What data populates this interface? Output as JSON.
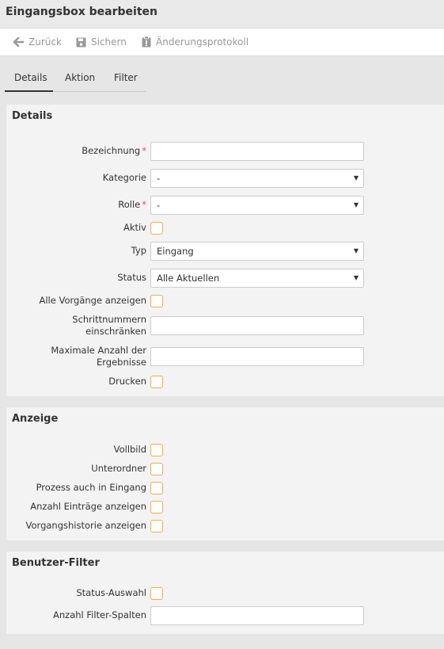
{
  "title": "Eingangsbox bearbeiten",
  "toolbar": {
    "back": "Zurück",
    "save": "Sichern",
    "changelog": "Änderungsprotokoll"
  },
  "tabs": [
    "Details",
    "Aktion",
    "Filter"
  ],
  "details": {
    "heading": "Details",
    "bezeichnung_label": "Bezeichnung",
    "kategorie_label": "Kategorie",
    "kategorie_value": "-",
    "rolle_label": "Rolle",
    "rolle_value": "-",
    "aktiv_label": "Aktiv",
    "typ_label": "Typ",
    "typ_value": "Eingang",
    "status_label": "Status",
    "status_value": "Alle Aktuellen",
    "alle_vorgaenge_label": "Alle Vorgänge anzeigen",
    "schrittnummern_label_1": "Schrittnummern",
    "schrittnummern_label_2": "einschränken",
    "max_anzahl_label_1": "Maximale Anzahl der",
    "max_anzahl_label_2": "Ergebnisse",
    "drucken_label": "Drucken",
    "required_mark": "*"
  },
  "anzeige": {
    "heading": "Anzeige",
    "vollbild_label": "Vollbild",
    "unterordner_label": "Unterordner",
    "prozess_label": "Prozess auch in Eingang",
    "anzahl_eintraege_label": "Anzahl Einträge anzeigen",
    "historie_label": "Vorgangshistorie anzeigen"
  },
  "benutzer_filter": {
    "heading": "Benutzer-Filter",
    "status_auswahl_label": "Status-Auswahl",
    "filter_spalten_label": "Anzahl Filter-Spalten"
  },
  "colors": {
    "checkbox_border": "#f0ad4e",
    "required": "#d9534f",
    "toolbar_text": "#999999"
  }
}
